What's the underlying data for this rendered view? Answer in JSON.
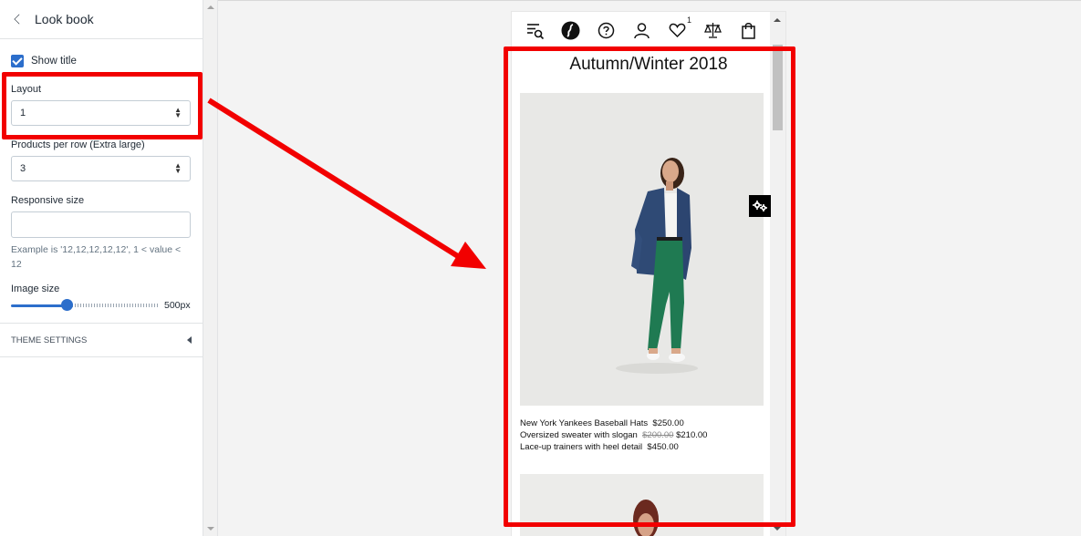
{
  "panel": {
    "title": "Look book",
    "show_title_label": "Show title",
    "layout_label": "Layout",
    "layout_value": "1",
    "products_per_row_label": "Products per row (Extra large)",
    "products_per_row_value": "3",
    "responsive_size_label": "Responsive size",
    "responsive_size_value": "",
    "responsive_help": "Example is '12,12,12,12,12', 1 < value < 12",
    "image_size_label": "Image size",
    "image_size_value": "500px",
    "image_size_level": 0.38,
    "theme_settings_label": "THEME SETTINGS"
  },
  "preview": {
    "header_icons": [
      "menu-search-icon",
      "logo-icon",
      "help-icon",
      "account-icon",
      "wishlist-icon",
      "compare-icon",
      "cart-icon"
    ],
    "wishlist_count": "1",
    "lookbook_title": "Autumn/Winter 2018",
    "products": [
      {
        "name": "New York Yankees Baseball Hats",
        "price": "$250.00",
        "old_price": ""
      },
      {
        "name": "Oversized sweater with slogan",
        "price": "$210.00",
        "old_price": "$200.00"
      },
      {
        "name": "Lace-up trainers with heel detail",
        "price": "$450.00",
        "old_price": ""
      }
    ]
  },
  "colors": {
    "accent": "#2c6ecb",
    "annotation_red": "#f20000"
  }
}
